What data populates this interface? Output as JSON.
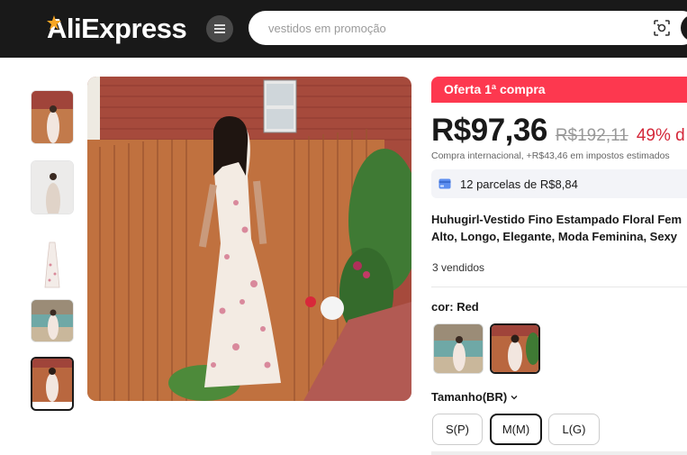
{
  "header": {
    "logo": "AliExpress",
    "search_placeholder": "vestidos em promoção"
  },
  "icons": {
    "menu": "menu-icon",
    "camera": "camera-search-icon",
    "installments": "card-icon",
    "chevron": "chevron-down-icon"
  },
  "colors": {
    "header_bg": "#191919",
    "promo_bg": "#fd384f",
    "discount": "#d4283a",
    "installments_bg": "#f3f4f8"
  },
  "gallery": {
    "thumbnails": [
      "thumb-1",
      "thumb-2",
      "thumb-3",
      "thumb-4",
      "thumb-5"
    ],
    "active_thumbnail_index": 4
  },
  "product": {
    "promo_badge": "Oferta 1ª compra",
    "price": "R$97,36",
    "old_price": "R$192,11",
    "discount": "49% d",
    "tax_note": "Compra internacional, +R$43,46 em impostos estimados",
    "installments": "12 parcelas de R$8,84",
    "title_line1": "Huhugirl-Vestido Fino Estampado Floral Fem",
    "title_line2": "Alto, Longo, Elegante, Moda Feminina, Sexy",
    "sold": "3 vendidos",
    "color_label": "cor:",
    "color_value": "Red",
    "size_label": "Tamanho(BR)",
    "sizes": [
      "S(P)",
      "M(M)",
      "L(G)"
    ],
    "selected_size": "M(M)"
  }
}
